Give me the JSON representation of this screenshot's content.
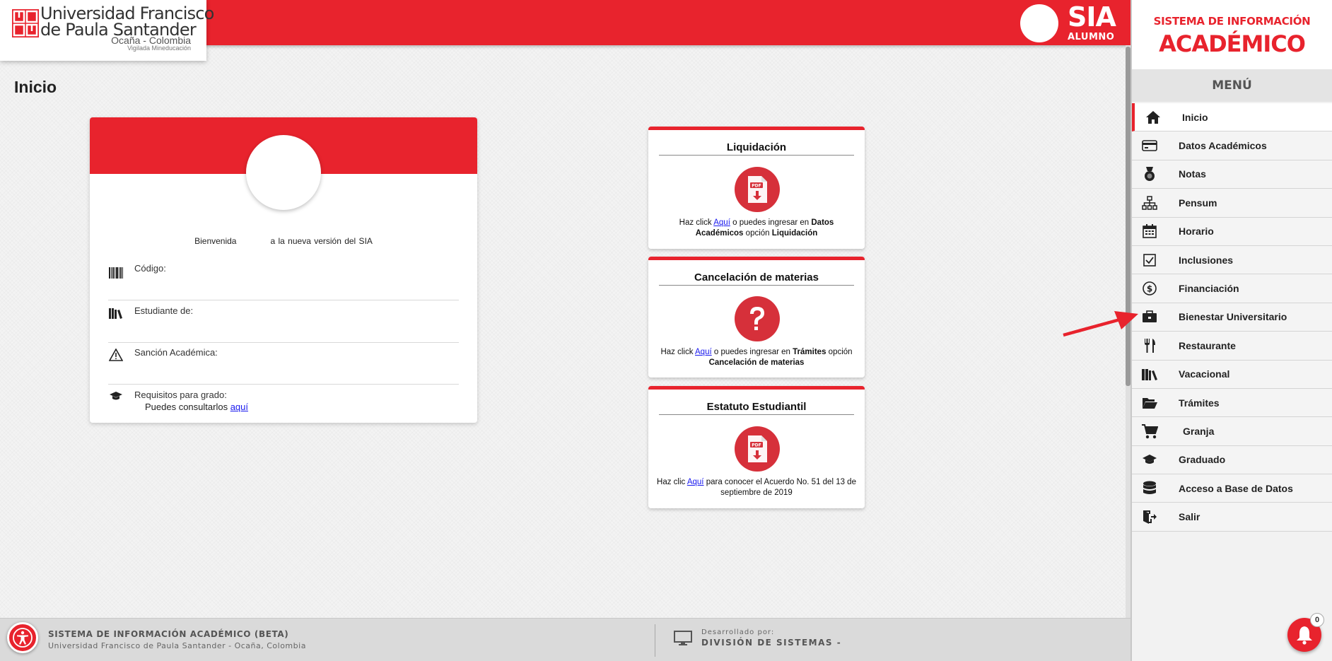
{
  "header": {
    "university_name_line1": "Universidad Francisco",
    "university_name_line2": "de Paula Santander",
    "university_location": "Ocaña - Colombia",
    "university_tagline": "Vigilada Mineducación",
    "app_name": "SIA",
    "app_sub": "ALUMNO"
  },
  "side_panel": {
    "system_label": "SISTEMA DE INFORMACIÓN",
    "system_title": "ACADÉMICO",
    "menu_title": "MENÚ",
    "items": [
      {
        "label": "Inicio",
        "icon": "home-icon",
        "active": true
      },
      {
        "label": "Datos Académicos",
        "icon": "card-icon"
      },
      {
        "label": "Notas",
        "icon": "medal-icon"
      },
      {
        "label": "Pensum",
        "icon": "sitemap-icon"
      },
      {
        "label": "Horario",
        "icon": "calendar-icon"
      },
      {
        "label": "Inclusiones",
        "icon": "checkbox-icon"
      },
      {
        "label": "Financiación",
        "icon": "dollar-icon"
      },
      {
        "label": "Bienestar Universitario",
        "icon": "briefcase-icon"
      },
      {
        "label": "Restaurante",
        "icon": "utensils-icon"
      },
      {
        "label": "Vacacional",
        "icon": "books-icon"
      },
      {
        "label": "Trámites",
        "icon": "folder-icon"
      },
      {
        "label": "Granja",
        "icon": "cart-icon"
      },
      {
        "label": "Graduado",
        "icon": "graduation-cap-icon"
      },
      {
        "label": "Acceso a Base de Datos",
        "icon": "database-icon"
      },
      {
        "label": "Salir",
        "icon": "logout-icon"
      }
    ]
  },
  "page": {
    "title": "Inicio"
  },
  "profile": {
    "welcome_start": "Bienvenida",
    "welcome_end": "a la nueva versión del SIA",
    "rows": [
      {
        "label": "Código:",
        "icon": "barcode-icon"
      },
      {
        "label": "Estudiante de:",
        "icon": "books-icon"
      },
      {
        "label": "Sanción Académica:",
        "icon": "warning-icon"
      },
      {
        "label": "Requisitos para grado:",
        "icon": "graduation-cap-icon",
        "extra_text": "Puedes consultarlos",
        "extra_link": "aquí"
      }
    ]
  },
  "cards": [
    {
      "title": "Liquidación",
      "icon": "pdf-download-icon",
      "text_pre": "Haz click",
      "link": "Aquí",
      "text_mid": "o puedes ingresar en",
      "bold1": "Datos Académicos",
      "text_post": "opción",
      "bold2": "Liquidación"
    },
    {
      "title": "Cancelación de materias",
      "icon": "question-icon",
      "text_pre": "Haz click",
      "link": "Aquí",
      "text_mid": "o puedes ingresar en",
      "bold1": "Trámites",
      "text_post": "opción",
      "bold2": "Cancelación de materias"
    },
    {
      "title": "Estatuto Estudiantil",
      "icon": "pdf-download-icon",
      "text_pre": "Haz clic",
      "link": "Aquí",
      "text_mid": "para conocer el Acuerdo No. 51 del 13 de septiembre de 2019"
    }
  ],
  "footer": {
    "system_name": "SISTEMA DE INFORMACIÓN ACADÉMICO (BETA)",
    "university_line": "Universidad Francisco de Paula Santander - Ocaña, Colombia",
    "developed_by_label": "Desarrollado por:",
    "developer": "DIVISIÓN DE SISTEMAS -"
  },
  "notifications": {
    "count": "0"
  },
  "colors": {
    "brand_red": "#e8232d",
    "link_blue": "#1a1aee"
  }
}
